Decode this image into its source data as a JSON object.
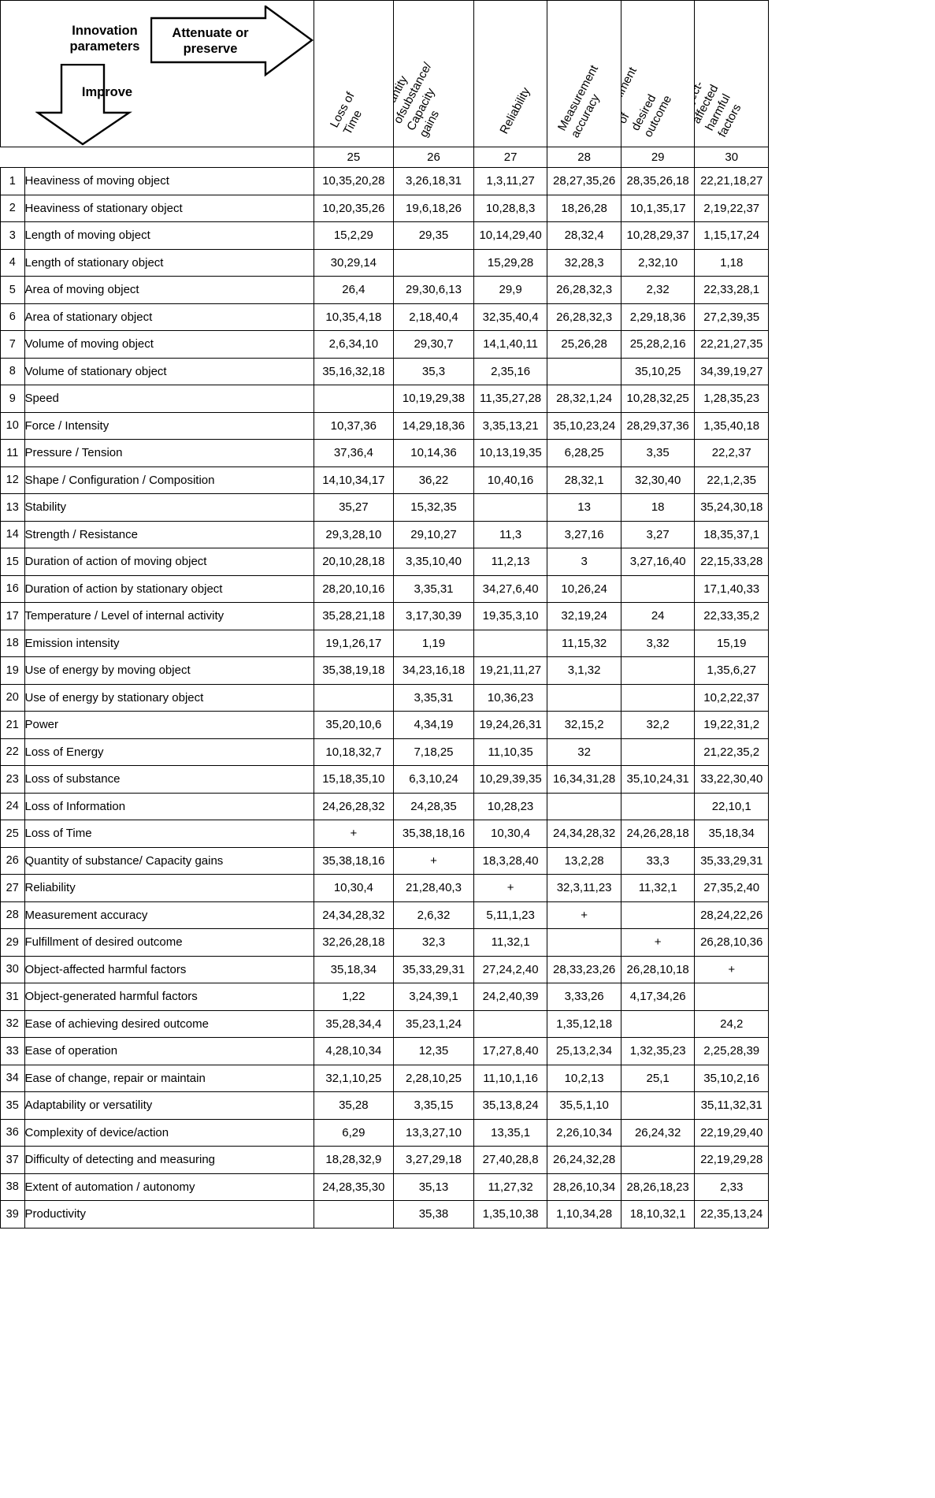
{
  "legend": {
    "innovation_label": "Innovation\nparameters",
    "improve_label": "Improve",
    "attenuate_label": "Attenuate or\npreserve"
  },
  "columns": [
    {
      "number": "25",
      "label": "Loss of Time"
    },
    {
      "number": "26",
      "label": "Quantity ofsubstance/\nCapacity gains"
    },
    {
      "number": "27",
      "label": "Reliability"
    },
    {
      "number": "28",
      "label": "Measurement\naccuracy"
    },
    {
      "number": "29",
      "label": "Fulfillment  of\ndesired outcome"
    },
    {
      "number": "30",
      "label": "Object-affected\nharmful factors"
    }
  ],
  "rows": [
    {
      "n": "1",
      "label": "Heaviness of moving object",
      "cells": [
        "10,35,20,28",
        "3,26,18,31",
        "1,3,11,27",
        "28,27,35,26",
        "28,35,26,18",
        "22,21,18,27"
      ]
    },
    {
      "n": "2",
      "label": "Heaviness  of stationary object",
      "cells": [
        "10,20,35,26",
        "19,6,18,26",
        "10,28,8,3",
        "18,26,28",
        "10,1,35,17",
        "2,19,22,37"
      ]
    },
    {
      "n": "3",
      "label": "Length of moving object",
      "cells": [
        "15,2,29",
        "29,35",
        "10,14,29,40",
        "28,32,4",
        "10,28,29,37",
        "1,15,17,24"
      ]
    },
    {
      "n": "4",
      "label": "Length of stationary object",
      "cells": [
        "30,29,14",
        "",
        "15,29,28",
        "32,28,3",
        "2,32,10",
        "1,18"
      ]
    },
    {
      "n": "5",
      "label": "Area of moving object",
      "cells": [
        "26,4",
        "29,30,6,13",
        "29,9",
        "26,28,32,3",
        "2,32",
        "22,33,28,1"
      ]
    },
    {
      "n": "6",
      "label": "Area of stationary object",
      "cells": [
        "10,35,4,18",
        "2,18,40,4",
        "32,35,40,4",
        "26,28,32,3",
        "2,29,18,36",
        "27,2,39,35"
      ]
    },
    {
      "n": "7",
      "label": "Volume of  moving object",
      "cells": [
        "2,6,34,10",
        "29,30,7",
        "14,1,40,11",
        "25,26,28",
        "25,28,2,16",
        "22,21,27,35"
      ]
    },
    {
      "n": "8",
      "label": "Volume of stationary object",
      "cells": [
        "35,16,32,18",
        "35,3",
        "2,35,16",
        "",
        "35,10,25",
        "34,39,19,27"
      ]
    },
    {
      "n": "9",
      "label": "Speed",
      "cells": [
        "",
        "10,19,29,38",
        "11,35,27,28",
        "28,32,1,24",
        "10,28,32,25",
        "1,28,35,23"
      ]
    },
    {
      "n": "10",
      "label": "Force / Intensity",
      "cells": [
        "10,37,36",
        "14,29,18,36",
        "3,35,13,21",
        "35,10,23,24",
        "28,29,37,36",
        "1,35,40,18"
      ]
    },
    {
      "n": "11",
      "label": "Pressure / Tension",
      "cells": [
        "37,36,4",
        "10,14,36",
        "10,13,19,35",
        "6,28,25",
        "3,35",
        "22,2,37"
      ]
    },
    {
      "n": "12",
      "label": "Shape / Configuration / Composition",
      "cells": [
        "14,10,34,17",
        "36,22",
        "10,40,16",
        "28,32,1",
        "32,30,40",
        "22,1,2,35"
      ]
    },
    {
      "n": "13",
      "label": "Stability",
      "cells": [
        "35,27",
        "15,32,35",
        "",
        "13",
        "18",
        "35,24,30,18"
      ]
    },
    {
      "n": "14",
      "label": "Strength / Resistance",
      "cells": [
        "29,3,28,10",
        "29,10,27",
        "11,3",
        "3,27,16",
        "3,27",
        "18,35,37,1"
      ]
    },
    {
      "n": "15",
      "label": "Duration of action of moving object",
      "cells": [
        "20,10,28,18",
        "3,35,10,40",
        "11,2,13",
        "3",
        "3,27,16,40",
        "22,15,33,28"
      ]
    },
    {
      "n": "16",
      "label": "Duration of action by stationary object",
      "cells": [
        "28,20,10,16",
        "3,35,31",
        "34,27,6,40",
        "10,26,24",
        "",
        "17,1,40,33"
      ]
    },
    {
      "n": "17",
      "label": "Temperature / Level of internal activity",
      "cells": [
        "35,28,21,18",
        "3,17,30,39",
        "19,35,3,10",
        "32,19,24",
        "24",
        "22,33,35,2"
      ]
    },
    {
      "n": "18",
      "label": "Emission intensity",
      "cells": [
        "19,1,26,17",
        "1,19",
        "",
        "11,15,32",
        "3,32",
        "15,19"
      ]
    },
    {
      "n": "19",
      "label": "Use of energy by moving object",
      "cells": [
        "35,38,19,18",
        "34,23,16,18",
        "19,21,11,27",
        "3,1,32",
        "",
        "1,35,6,27"
      ]
    },
    {
      "n": "20",
      "label": "Use of energy by stationary object",
      "cells": [
        "",
        "3,35,31",
        "10,36,23",
        "",
        "",
        "10,2,22,37"
      ]
    },
    {
      "n": "21",
      "label": " Power",
      "cells": [
        "35,20,10,6",
        "4,34,19",
        "19,24,26,31",
        "32,15,2",
        "32,2",
        "19,22,31,2"
      ]
    },
    {
      "n": "22",
      "label": "Loss of Energy",
      "cells": [
        "10,18,32,7",
        "7,18,25",
        "11,10,35",
        "32",
        "",
        "21,22,35,2"
      ]
    },
    {
      "n": "23",
      "label": "Loss of substance",
      "cells": [
        "15,18,35,10",
        "6,3,10,24",
        "10,29,39,35",
        "16,34,31,28",
        "35,10,24,31",
        "33,22,30,40"
      ]
    },
    {
      "n": "24",
      "label": "Loss of Information",
      "cells": [
        "24,26,28,32",
        "24,28,35",
        "10,28,23",
        "",
        "",
        "22,10,1"
      ]
    },
    {
      "n": "25",
      "label": "Loss of Time",
      "cells": [
        "+",
        "35,38,18,16",
        "10,30,4",
        "24,34,28,32",
        "24,26,28,18",
        "35,18,34"
      ]
    },
    {
      "n": "26",
      "label": "Quantity of substance/ Capacity gains",
      "cells": [
        "35,38,18,16",
        "+",
        "18,3,28,40",
        "13,2,28",
        "33,3",
        "35,33,29,31"
      ]
    },
    {
      "n": "27",
      "label": "Reliability",
      "cells": [
        "10,30,4",
        "21,28,40,3",
        "+",
        "32,3,11,23",
        "11,32,1",
        "27,35,2,40"
      ]
    },
    {
      "n": "28",
      "label": "Measurement accuracy",
      "cells": [
        "24,34,28,32",
        "2,6,32",
        "5,11,1,23",
        "+",
        "",
        "28,24,22,26"
      ]
    },
    {
      "n": "29",
      "label": " Fulfillment of desired outcome",
      "cells": [
        "32,26,28,18",
        "32,3",
        "11,32,1",
        "",
        "+",
        "26,28,10,36"
      ]
    },
    {
      "n": "30",
      "label": "Object-affected harmful factors",
      "cells": [
        "35,18,34",
        "35,33,29,31",
        "27,24,2,40",
        "28,33,23,26",
        "26,28,10,18",
        "+"
      ]
    },
    {
      "n": "31",
      "label": "Object-generated harmful factors",
      "cells": [
        "1,22",
        "3,24,39,1",
        "24,2,40,39",
        "3,33,26",
        "4,17,34,26",
        ""
      ]
    },
    {
      "n": "32",
      "label": "Ease of achieving desired outcome",
      "cells": [
        "35,28,34,4",
        "35,23,1,24",
        "",
        "1,35,12,18",
        "",
        "24,2"
      ]
    },
    {
      "n": "33",
      "label": "Ease of operation",
      "cells": [
        "4,28,10,34",
        "12,35",
        "17,27,8,40",
        "25,13,2,34",
        "1,32,35,23",
        "2,25,28,39"
      ]
    },
    {
      "n": "34",
      "label": "Ease of change, repair or maintain",
      "cells": [
        "32,1,10,25",
        "2,28,10,25",
        "11,10,1,16",
        "10,2,13",
        "25,1",
        "35,10,2,16"
      ]
    },
    {
      "n": "35",
      "label": "Adaptability or versatility",
      "cells": [
        "35,28",
        "3,35,15",
        "35,13,8,24",
        "35,5,1,10",
        "",
        "35,11,32,31"
      ]
    },
    {
      "n": "36",
      "label": "Complexity of device/action",
      "cells": [
        "6,29",
        "13,3,27,10",
        "13,35,1",
        "2,26,10,34",
        "26,24,32",
        "22,19,29,40"
      ]
    },
    {
      "n": "37",
      "label": "Difficulty of detecting and measuring",
      "cells": [
        "18,28,32,9",
        "3,27,29,18",
        "27,40,28,8",
        "26,24,32,28",
        "",
        "22,19,29,28"
      ]
    },
    {
      "n": "38",
      "label": "Extent of automation / autonomy",
      "cells": [
        "24,28,35,30",
        "35,13",
        "11,27,32",
        "28,26,10,34",
        "28,26,18,23",
        "2,33"
      ]
    },
    {
      "n": "39",
      "label": "Productivity",
      "cells": [
        "",
        "35,38",
        "1,35,10,38",
        "1,10,34,28",
        "18,10,32,1",
        "22,35,13,24"
      ]
    }
  ],
  "colors": {
    "border": "#000000",
    "background": "#ffffff",
    "text": "#000000"
  }
}
